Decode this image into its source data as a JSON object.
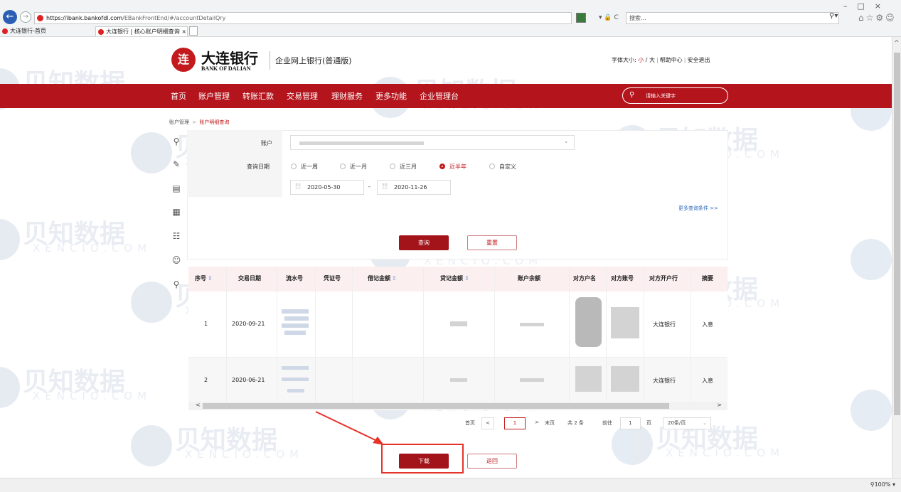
{
  "browser": {
    "url_host": "https://ibank.bankofdl.com",
    "url_path": "/EBankFrontEnd/#/accountDetailQry",
    "search_placeholder": "搜索...",
    "tabs": [
      {
        "label": "大连银行-首页"
      },
      {
        "label": "大连银行 | 核心账户明细查询 ×"
      }
    ],
    "zoom": "100%"
  },
  "header": {
    "logo_char": "连",
    "bank_name_cn": "大连银行",
    "bank_name_en": "BANK OF DALIAN",
    "site_name": "企业网上银行(普通版)",
    "font_size_label": "字体大小:",
    "font_small": "小",
    "font_slash": "/",
    "font_large": "大",
    "help": "帮助中心",
    "logout": "安全退出"
  },
  "nav": {
    "items": [
      "首页",
      "账户管理",
      "转账汇款",
      "交易管理",
      "理财服务",
      "更多功能",
      "企业管理台"
    ],
    "search_placeholder": "请输入关键字"
  },
  "breadcrumb": {
    "parent": "账户管理",
    "separator": ">",
    "current": "账户明细查询"
  },
  "form": {
    "account_label": "账户",
    "date_label": "查询日期",
    "ranges": [
      "近一周",
      "近一月",
      "近三月",
      "近半年",
      "自定义"
    ],
    "selected_range": "近半年",
    "start_date": "2020-05-30",
    "end_date": "2020-11-26",
    "date_sep": "–",
    "more_conditions": "更多查询条件 >>",
    "query_button": "查询",
    "reset_button": "重置"
  },
  "table": {
    "columns": [
      "序号",
      "交易日期",
      "流水号",
      "凭证号",
      "借记金额",
      "贷记金额",
      "账户余额",
      "对方户名",
      "对方账号",
      "对方开户行",
      "摘要"
    ],
    "rows": [
      {
        "seq": "1",
        "date": "2020-09-21",
        "bank": "大连银行",
        "summary": "入息"
      },
      {
        "seq": "2",
        "date": "2020-06-21",
        "bank": "大连银行",
        "summary": "入息"
      }
    ]
  },
  "pagination": {
    "first": "首页",
    "prev": "<",
    "current": "1",
    "next": ">",
    "last": "末页",
    "total": "共 2 条",
    "goto": "前往",
    "goto_value": "1",
    "page_unit": "页",
    "page_size": "20条/页"
  },
  "actions": {
    "download": "下载",
    "back": "返回"
  },
  "watermark": {
    "cn": "贝知数据",
    "en": "XENCIO.COM"
  },
  "colors": {
    "brand_red": "#b4141c",
    "button_red": "#a3131a",
    "link_blue": "#2a67b8",
    "highlight": "#e6332a"
  }
}
